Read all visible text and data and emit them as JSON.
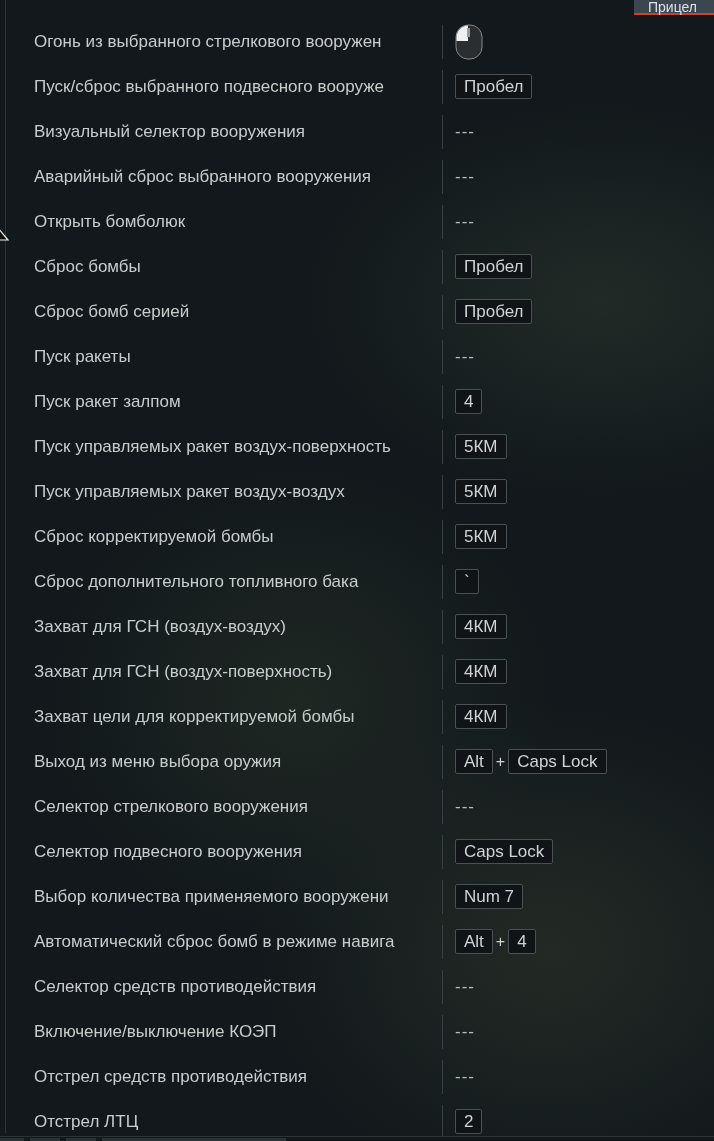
{
  "top_tab": {
    "label": "Прицел",
    "selected": true
  },
  "bindings": [
    {
      "action": "Огонь из выбранного стрелкового вооружен",
      "binding": {
        "kind": "mouse"
      }
    },
    {
      "action": "Пуск/сброс выбранного подвесного вооруже",
      "binding": {
        "kind": "keys",
        "keys": [
          "Пробел"
        ]
      }
    },
    {
      "action": "Визуальный селектор вооружения",
      "binding": {
        "kind": "none",
        "text": "---"
      }
    },
    {
      "action": "Аварийный сброс выбранного вооружения",
      "binding": {
        "kind": "none",
        "text": "---"
      }
    },
    {
      "action": "Открыть бомболюк",
      "binding": {
        "kind": "none",
        "text": "---"
      }
    },
    {
      "action": "Сброс бомбы",
      "binding": {
        "kind": "keys",
        "keys": [
          "Пробел"
        ]
      }
    },
    {
      "action": "Сброс бомб серией",
      "binding": {
        "kind": "keys",
        "keys": [
          "Пробел"
        ]
      }
    },
    {
      "action": "Пуск ракеты",
      "binding": {
        "kind": "none",
        "text": "---"
      }
    },
    {
      "action": "Пуск ракет залпом",
      "binding": {
        "kind": "keys",
        "keys": [
          "4"
        ]
      }
    },
    {
      "action": "Пуск управляемых ракет воздух-поверхность",
      "binding": {
        "kind": "keys",
        "keys": [
          "5КМ"
        ]
      }
    },
    {
      "action": "Пуск управляемых ракет воздух-воздух",
      "binding": {
        "kind": "keys",
        "keys": [
          "5КМ"
        ]
      }
    },
    {
      "action": "Сброс корректируемой бомбы",
      "binding": {
        "kind": "keys",
        "keys": [
          "5КМ"
        ]
      }
    },
    {
      "action": "Сброс дополнительного топливного бака",
      "binding": {
        "kind": "keys",
        "keys": [
          "`"
        ]
      }
    },
    {
      "action": "Захват для ГСН (воздух-воздух)",
      "binding": {
        "kind": "keys",
        "keys": [
          "4КМ"
        ]
      }
    },
    {
      "action": "Захват для ГСН (воздух-поверхность)",
      "binding": {
        "kind": "keys",
        "keys": [
          "4КМ"
        ]
      }
    },
    {
      "action": "Захват цели для корректируемой бомбы",
      "binding": {
        "kind": "keys",
        "keys": [
          "4КМ"
        ]
      }
    },
    {
      "action": "Выход из меню выбора оружия",
      "binding": {
        "kind": "keys",
        "keys": [
          "Alt",
          "Caps Lock"
        ],
        "joiner": "+"
      }
    },
    {
      "action": "Селектор стрелкового вооружения",
      "binding": {
        "kind": "none",
        "text": "---"
      }
    },
    {
      "action": "Селектор подвесного вооружения",
      "binding": {
        "kind": "keys",
        "keys": [
          "Caps Lock"
        ]
      }
    },
    {
      "action": "Выбор количества применяемого вооружени",
      "binding": {
        "kind": "keys",
        "keys": [
          "Num 7"
        ]
      }
    },
    {
      "action": "Автоматический сброс бомб в режиме навига",
      "binding": {
        "kind": "keys",
        "keys": [
          "Alt",
          "4"
        ],
        "joiner": "+"
      }
    },
    {
      "action": "Селектор средств противодействия",
      "binding": {
        "kind": "none",
        "text": "---"
      }
    },
    {
      "action": "Включение/выключение КОЭП",
      "binding": {
        "kind": "none",
        "text": "---"
      }
    },
    {
      "action": "Отстрел средств противодействия",
      "binding": {
        "kind": "none",
        "text": "---"
      }
    },
    {
      "action": "Отстрел ЛТЦ",
      "binding": {
        "kind": "keys",
        "keys": [
          "2"
        ]
      }
    }
  ]
}
